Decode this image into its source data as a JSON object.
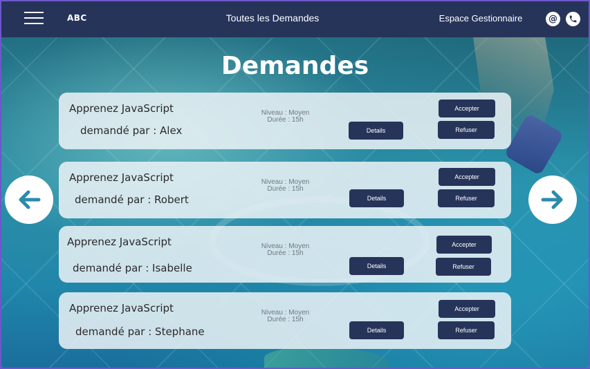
{
  "header": {
    "logo": "ABC",
    "title": "Toutes les Demandes",
    "space_link": "Espace Gestionnaire",
    "icons": [
      "menu-icon",
      "at-icon",
      "phone-icon"
    ]
  },
  "page": {
    "title": "Demandes"
  },
  "requests": [
    {
      "course": "Apprenez JavaScript",
      "requested_by": "demandé par : Alex",
      "level": "Niveau : Moyen",
      "duration": "Durée : 15h",
      "details_label": "Details",
      "accept_label": "Accepter",
      "refuse_label": "Refuser"
    },
    {
      "course": "Apprenez JavaScript",
      "requested_by": "demandé par : Robert",
      "level": "Niveau : Moyen",
      "duration": "Durée : 15h",
      "details_label": "Details",
      "accept_label": "Accepter",
      "refuse_label": "Refuser"
    },
    {
      "course": "Apprenez JavaScript",
      "requested_by": "demandé par : Isabelle",
      "level": "Niveau : Moyen",
      "duration": "Durée : 15h",
      "details_label": "Details",
      "accept_label": "Accepter",
      "refuse_label": "Refuser"
    },
    {
      "course": "Apprenez JavaScript",
      "requested_by": "demandé par : Stephane",
      "level": "Niveau : Moyen",
      "duration": "Durée : 15h",
      "details_label": "Details",
      "accept_label": "Accepter",
      "refuse_label": "Refuser"
    }
  ],
  "navigation": {
    "prev_icon": "arrow-left-icon",
    "next_icon": "arrow-right-icon"
  },
  "colors": {
    "header_bg": "#26345a",
    "button_bg": "#26345a",
    "arrow_color": "#2a8cab",
    "frame_border": "#6c58c9"
  }
}
